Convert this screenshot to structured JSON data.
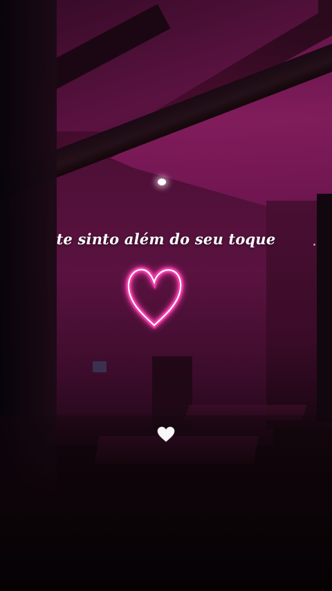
{
  "caption": {
    "text": "te sinto além do seu toque"
  },
  "icons": {
    "neon_heart": "neon-heart-sign",
    "emoji_heart": "white-heart-emoji"
  },
  "colors": {
    "neon_outer": "#ff3fb4",
    "neon_inner": "#ffffff",
    "ambient_magenta": "#8a1f63",
    "caption": "#ffffff"
  }
}
